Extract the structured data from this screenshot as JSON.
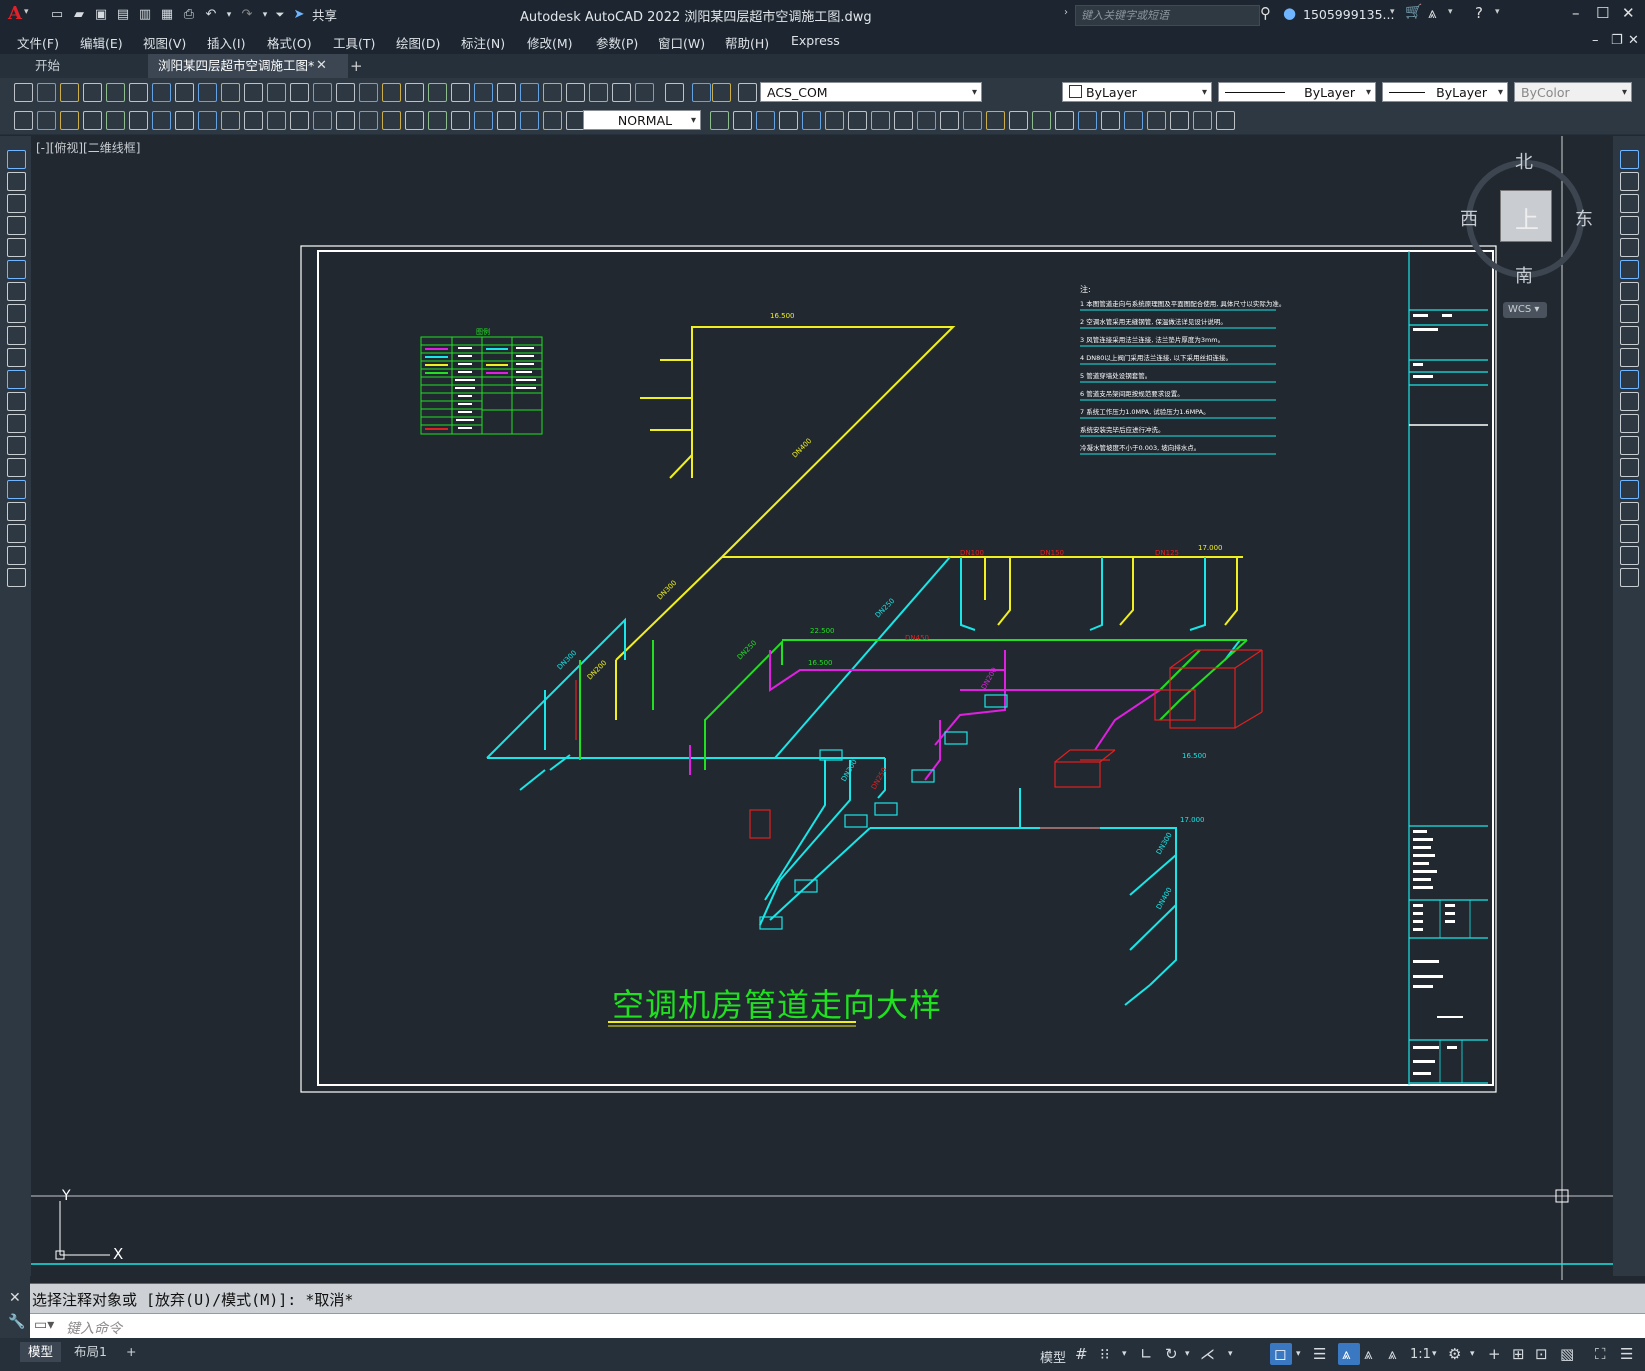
{
  "app": {
    "title": "Autodesk AutoCAD 2022    浏阳某四层超市空调施工图.dwg",
    "share_label": "共享",
    "search_placeholder": "键入关键字或短语",
    "user": "1505999135..."
  },
  "menu": [
    "文件(F)",
    "编辑(E)",
    "视图(V)",
    "插入(I)",
    "格式(O)",
    "工具(T)",
    "绘图(D)",
    "标注(N)",
    "修改(M)",
    "参数(P)",
    "窗口(W)",
    "帮助(H)",
    "Express"
  ],
  "tabs": {
    "start": "开始",
    "active": "浏阳某四层超市空调施工图*",
    "add": "+"
  },
  "toolbar": {
    "layer": "ACS_COM",
    "color": "ByLayer",
    "linetype": "ByLayer",
    "lineweight": "ByLayer",
    "plotstyle": "ByColor",
    "dimstyle": "NORMAL"
  },
  "viewport": {
    "label": "[-][俯视][二维线框]"
  },
  "viewcube": {
    "north": "北",
    "south": "南",
    "east": "东",
    "west": "西",
    "top": "上",
    "wcs": "WCS"
  },
  "drawing": {
    "title": "空调机房管道走向大样",
    "notes_header": "注:",
    "notes": [
      "1 本图管道走向与系统原理图及平面图配合使用, 具体尺寸以实际为准。",
      "2 空调水管采用无缝钢管, 保温做法详见设计说明。",
      "3 风管连接采用法兰连接, 法兰垫片厚度为3mm。",
      "4 DN80以上阀门采用法兰连接, 以下采用丝扣连接。",
      "5 管道穿墙处设钢套管。",
      "6 管道支吊架间距按规范要求设置。",
      "7 系统工作压力1.0MPA, 试验压力1.6MPA。",
      "系统安装完毕后应进行冲洗。",
      "冷凝水管坡度不小于0.003, 坡向排水点。"
    ],
    "legend_header": "图例",
    "labels": [
      "DN400",
      "DN300",
      "DN250",
      "DN200",
      "DN150",
      "DN125",
      "DN100",
      "16.500",
      "17.000",
      "22.500",
      "16.500",
      "17.000",
      "DN450"
    ],
    "axis_y": "Y",
    "axis_x": "X"
  },
  "command": {
    "history": "选择注释对象或 [放弃(U)/模式(M)]: *取消*",
    "placeholder": "键入命令"
  },
  "status": {
    "model_tab": "模型",
    "layout_tab": "布局1",
    "add": "+",
    "model_btn": "模型",
    "scale": "1:1"
  },
  "colors": {
    "cyan": "#19e6e6",
    "yellow": "#f0f020",
    "green": "#20e020",
    "magenta": "#e020e0",
    "red": "#e02020",
    "white": "#ffffff"
  }
}
